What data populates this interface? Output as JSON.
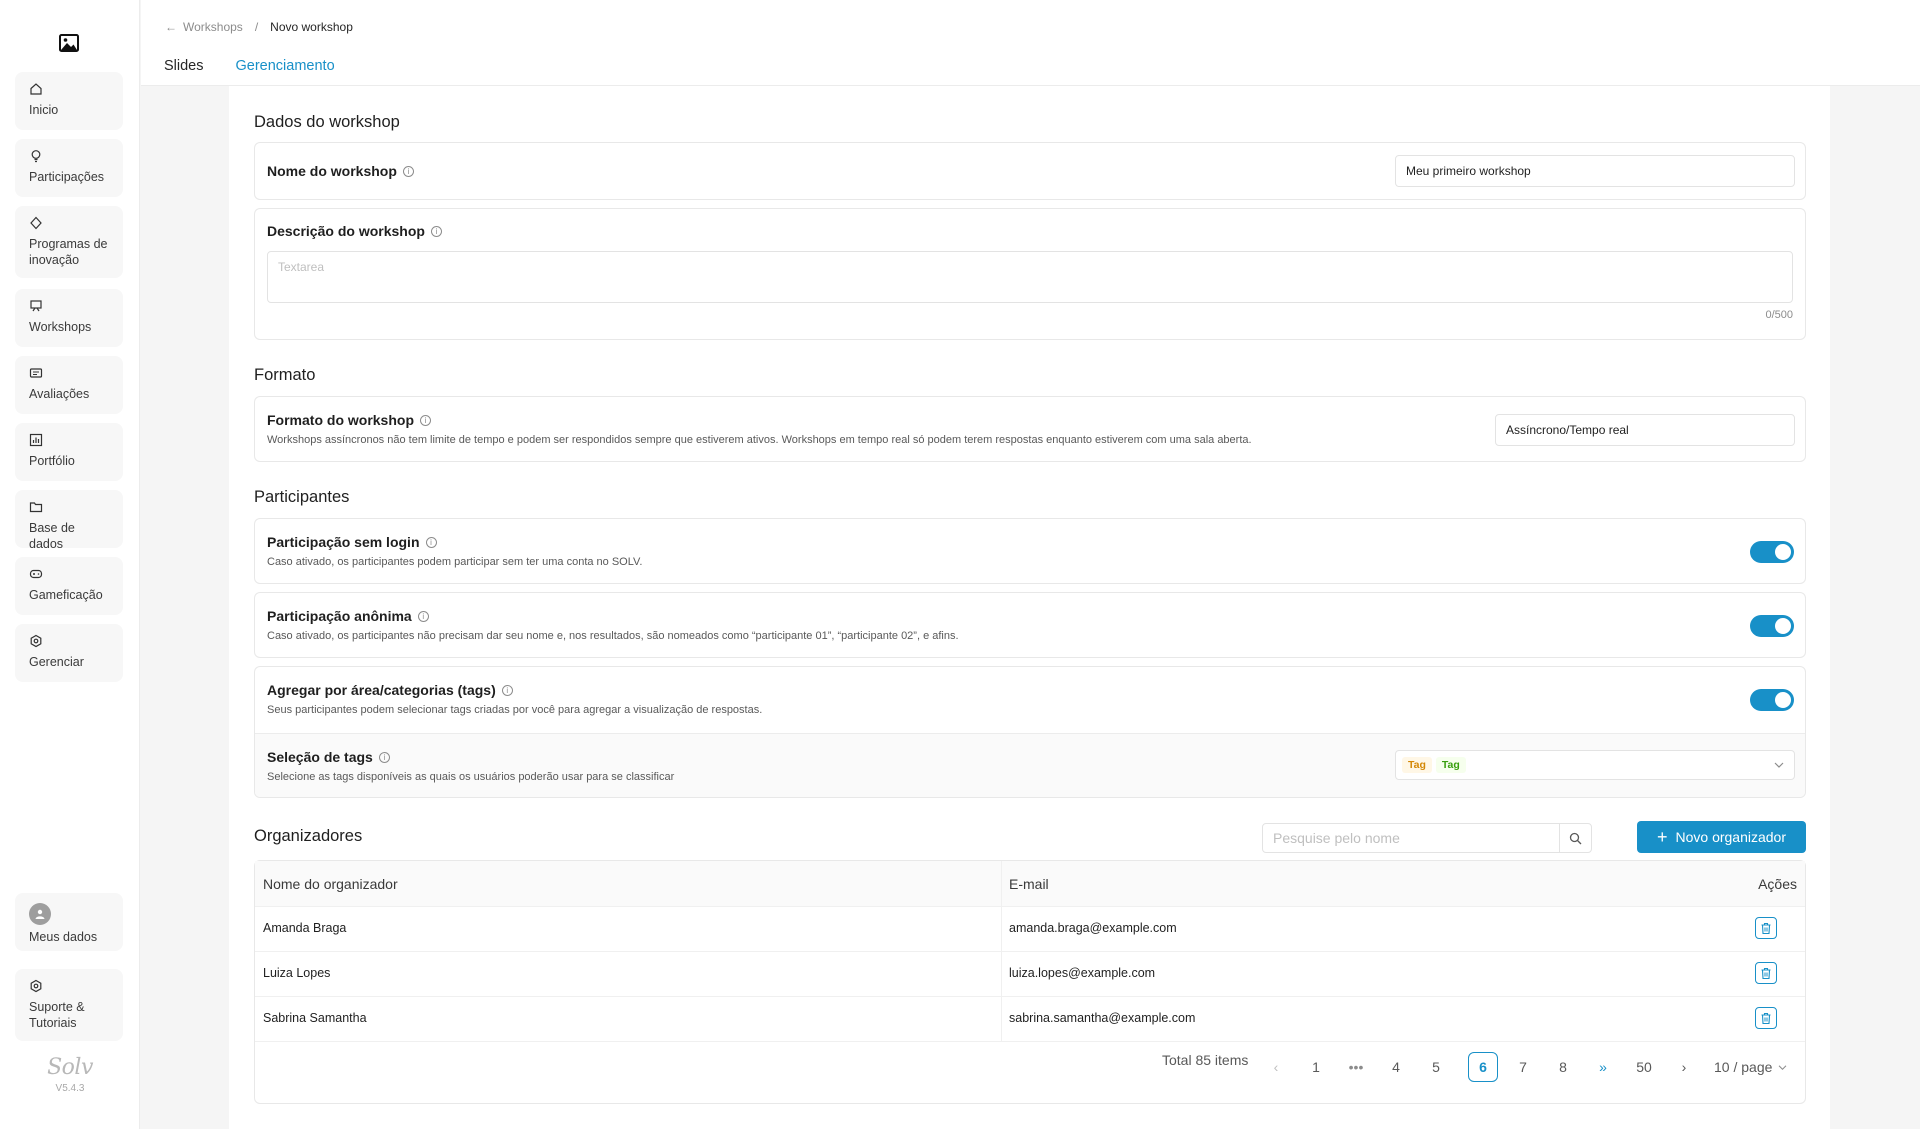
{
  "sidebar": {
    "items": [
      {
        "label": "Inicio",
        "icon": "home-icon"
      },
      {
        "label": "Participações",
        "icon": "lightbulb-icon"
      },
      {
        "label": "Programas de inovação",
        "icon": "diamond-icon"
      },
      {
        "label": "Workshops",
        "icon": "workshop-icon"
      },
      {
        "label": "Avaliações",
        "icon": "rating-icon"
      },
      {
        "label": "Portfólio",
        "icon": "chart-icon"
      },
      {
        "label": "Base de dados",
        "icon": "folder-icon"
      },
      {
        "label": "Gameficação",
        "icon": "gamepad-icon"
      },
      {
        "label": "Gerenciar",
        "icon": "settings-icon"
      }
    ],
    "bottom": [
      {
        "label": "Meus dados",
        "icon": "avatar-icon"
      },
      {
        "label": "Suporte & Tutoriais",
        "icon": "support-icon"
      }
    ],
    "brand": "Solv",
    "version": "V5.4.3"
  },
  "breadcrumb": {
    "parent": "Workshops",
    "separator": "/",
    "current": "Novo workshop"
  },
  "tabs": [
    {
      "label": "Slides"
    },
    {
      "label": "Gerenciamento"
    }
  ],
  "sections": {
    "dados": "Dados do workshop",
    "formato": "Formato",
    "participantes": "Participantes",
    "organizadores": "Organizadores"
  },
  "fields": {
    "nome": {
      "label": "Nome do workshop",
      "value": "Meu primeiro workshop"
    },
    "descricao": {
      "label": "Descrição do workshop",
      "placeholder": "Textarea",
      "counter": "0/500"
    },
    "formato": {
      "label": "Formato do workshop",
      "desc": "Workshops assíncronos não tem limite de tempo e podem ser respondidos sempre que estiverem ativos. Workshops em tempo real só podem terem respostas enquanto estiverem com uma sala aberta.",
      "value": "Assíncrono/Tempo real"
    },
    "sem_login": {
      "label": "Participação sem login",
      "desc": "Caso ativado, os participantes podem participar sem ter uma conta no SOLV.",
      "enabled": true
    },
    "anonima": {
      "label": "Participação anônima",
      "desc": "Caso ativado, os participantes não precisam dar seu nome e, nos resultados, são nomeados como “participante 01”, “participante 02”, e afins.",
      "enabled": true
    },
    "agregar": {
      "label": "Agregar por área/categorias (tags)",
      "desc": "Seus participantes podem selecionar tags criadas por você para agregar a visualização de respostas.",
      "enabled": true
    },
    "selecao": {
      "label": "Seleção de tags",
      "desc": "Selecione as tags disponíveis as quais os usuários poderão usar para se classificar",
      "tags": [
        "Tag",
        "Tag"
      ]
    }
  },
  "organizers": {
    "search_placeholder": "Pesquise pelo nome",
    "new_button": "Novo organizador",
    "columns": [
      "Nome do organizador",
      "E-mail",
      "Ações"
    ],
    "rows": [
      {
        "name": "Amanda Braga",
        "email": "amanda.braga@example.com"
      },
      {
        "name": "Luiza Lopes",
        "email": "luiza.lopes@example.com"
      },
      {
        "name": "Sabrina Samantha",
        "email": "sabrina.samantha@example.com"
      }
    ]
  },
  "pagination": {
    "total": "Total 85 items",
    "pages": [
      "1",
      "•••",
      "4",
      "5",
      "6",
      "7",
      "8",
      "»",
      "50"
    ],
    "current": "6",
    "page_size": "10 / page"
  },
  "colors": {
    "accent": "#1890c8",
    "tag_orange": "#d48806",
    "tag_green": "#389e0d"
  }
}
